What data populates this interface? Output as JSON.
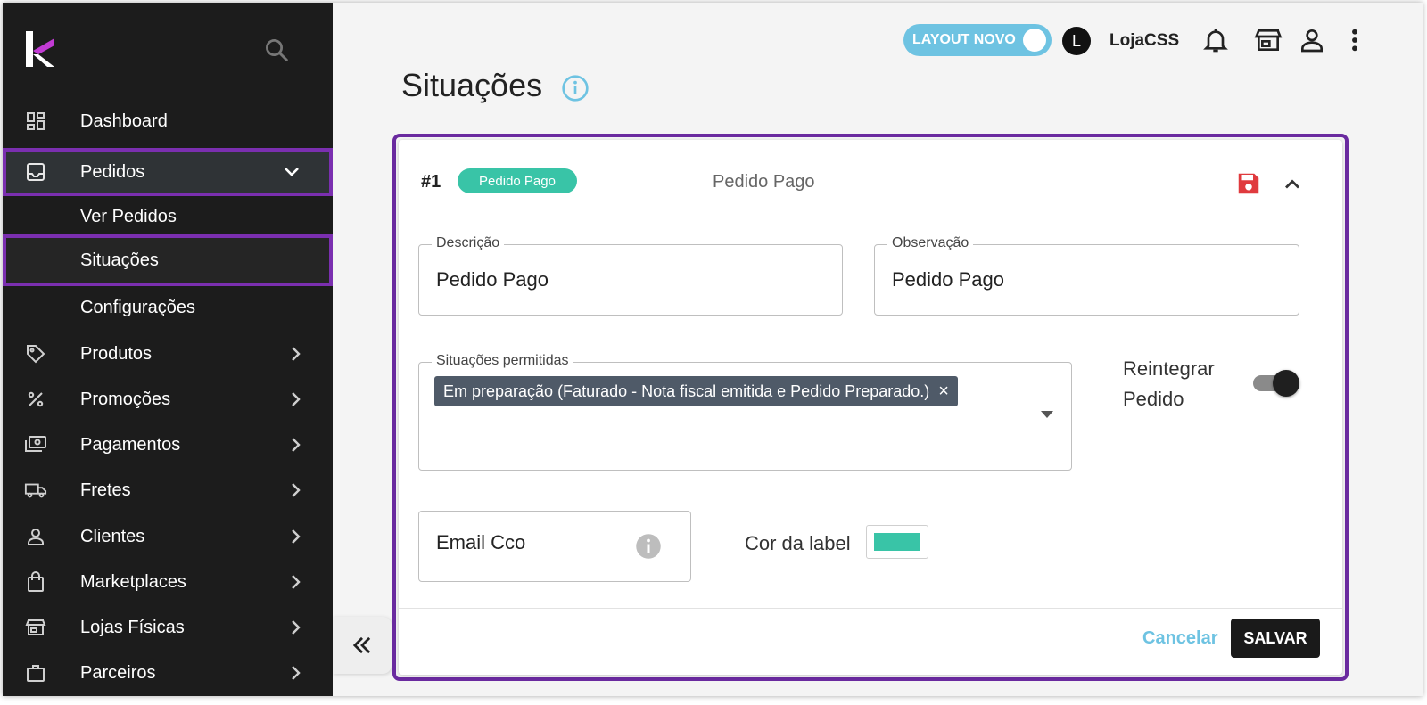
{
  "sidebar": {
    "items": [
      {
        "label": "Dashboard",
        "icon": "dashboard-icon"
      },
      {
        "label": "Pedidos",
        "icon": "inbox-icon"
      },
      {
        "label": "Ver Pedidos"
      },
      {
        "label": "Situações"
      },
      {
        "label": "Configurações"
      },
      {
        "label": "Produtos",
        "icon": "tag-icon"
      },
      {
        "label": "Promoções",
        "icon": "percent-icon"
      },
      {
        "label": "Pagamentos",
        "icon": "payments-icon"
      },
      {
        "label": "Fretes",
        "icon": "truck-icon"
      },
      {
        "label": "Clientes",
        "icon": "person-icon"
      },
      {
        "label": "Marketplaces",
        "icon": "shopping-bag-icon"
      },
      {
        "label": "Lojas Físicas",
        "icon": "storefront-icon"
      },
      {
        "label": "Parceiros",
        "icon": "briefcase-icon"
      }
    ]
  },
  "topbar": {
    "layout_toggle_label": "LAYOUT NOVO",
    "avatar_initial": "L",
    "store_name": "LojaCSS"
  },
  "page": {
    "title": "Situações"
  },
  "card": {
    "number": "#1",
    "chip_label": "Pedido Pago",
    "chip_color": "#39c4a7",
    "header_text": "Pedido Pago",
    "descricao_label": "Descrição",
    "descricao_value": "Pedido Pago",
    "observacao_label": "Observação",
    "observacao_value": "Pedido Pago",
    "situacoes_label": "Situações permitidas",
    "situacoes_tag": "Em preparação (Faturado - Nota fiscal emitida e Pedido Preparado.)",
    "reintegrar_line1": "Reintegrar",
    "reintegrar_line2": "Pedido",
    "email_label": "Email Cco",
    "cor_label": "Cor da label",
    "label_color": "#39c4a7",
    "cancel_label": "Cancelar",
    "save_label": "SALVAR"
  },
  "colors": {
    "sidebar_bg": "#1c1c1c",
    "accent_purple": "#6a2a9f",
    "toggle_blue": "#6ec3e2",
    "save_icon_red": "#e03a3e"
  }
}
